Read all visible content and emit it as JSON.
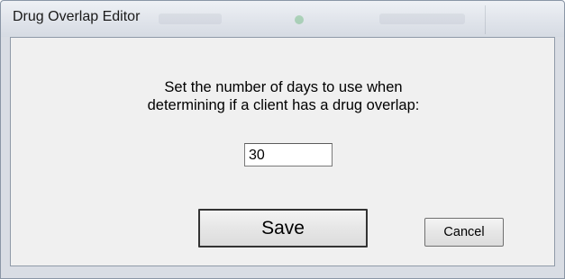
{
  "window": {
    "title": "Drug Overlap Editor"
  },
  "prompt": {
    "line1": "Set the number of days to use when",
    "line2": "determining if a client has a drug overlap:"
  },
  "days_field": {
    "value": "30"
  },
  "buttons": {
    "save_label": "Save",
    "cancel_label": "Cancel"
  },
  "colors": {
    "window_frame": "#d9dde4",
    "client_area": "#f0f0f0",
    "text": "#000000"
  }
}
